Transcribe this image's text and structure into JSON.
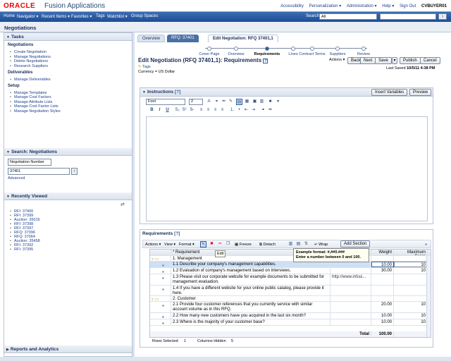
{
  "header": {
    "logo": "ORACLE",
    "app_name": "Fusion Applications",
    "links": [
      "Accessibility",
      "Personalization ▾",
      "Administration ▾",
      "Help ▾",
      "Sign Out",
      "CVBUYER01"
    ]
  },
  "nav": {
    "items": [
      "Home",
      "Navigator ▾",
      "Recent Items ▾",
      "Favorites ▾",
      "Tags",
      "Watchlist ▾",
      "Group Spaces"
    ],
    "search_label": "Search",
    "search_scope": "All"
  },
  "page_title": "Negotiations",
  "tasks": {
    "title": "Tasks",
    "groups": [
      {
        "label": "Negotiations",
        "links": [
          "Create Negotiation",
          "Manage Negotiations",
          "Delete Negotiations",
          "Research Suppliers"
        ]
      },
      {
        "label": "Deliverables",
        "links": [
          "Manage Deliverables"
        ]
      },
      {
        "label": "Setup",
        "links": [
          "Manage Templates",
          "Manage Cost Factors",
          "Manage Attribute Lists",
          "Manage Cost Factor Lists",
          "Manage Negotiation Styles"
        ]
      }
    ]
  },
  "search_panel": {
    "title": "Search: Negotiations",
    "field": "Negotiation Number",
    "value": "37401",
    "advanced": "Advanced"
  },
  "recent": {
    "title": "Recently Viewed",
    "items": [
      "RFI: 37400",
      "RFI: 37399",
      "Auction: 35016",
      "RFI: 37398",
      "RFI: 37397",
      "RFQ: 37396",
      "RFQ: 37064",
      "Auction: 35458",
      "RFI: 37392",
      "RFI: 37395"
    ]
  },
  "reports": {
    "title": "Reports and Analytics"
  },
  "tabs": [
    "Overview",
    "RFQ: 37401",
    "Edit Negotiation: RFQ 37401,1"
  ],
  "train": [
    "Cover Page",
    "Overview",
    "Requirements",
    "Lines",
    "Contract Terms",
    "Suppliers",
    "Review"
  ],
  "form": {
    "title": "Edit Negotiation (RFQ 37401,1): Requirements",
    "tags": "Tags",
    "currency": "Currency = US Dollar",
    "actions": "Actions ▾",
    "back": "Back",
    "next": "Next",
    "save": "Save",
    "publish": "Publish",
    "cancel": "Cancel",
    "last_saved_label": "Last Saved",
    "last_saved": "10/5/11 4:38 PM"
  },
  "instructions": {
    "title": "Instructions",
    "insert_vars": "Insert Variables",
    "preview": "Preview",
    "font": "Font",
    "size": "2"
  },
  "requirements": {
    "title": "Requirements",
    "actions": "Actions ▾",
    "view": "View ▾",
    "format": "Format ▾",
    "freeze": "Freeze",
    "detach": "Detach",
    "wrap": "Wrap",
    "add_section": "Add Section",
    "edit_tip": "Edit",
    "tip_line1": "Example format: #,##0.###",
    "tip_line2": "Enter a number between 0 and 100.",
    "columns": [
      "* Requirement",
      "",
      "Weight",
      "Maximum Score"
    ],
    "rows": [
      {
        "text": "1. Management",
        "section": true,
        "value": "",
        "weight": "",
        "max": ""
      },
      {
        "text": "1.1 Describe your company's management capabilities.",
        "section": false,
        "value": "",
        "weight": "10.00",
        "max": "10",
        "selected": true
      },
      {
        "text": "1.2 Evaluation of company's management based on interviews.",
        "section": false,
        "value": "",
        "weight": "30.00",
        "max": "10"
      },
      {
        "text": "1.3 Please visit our corporate website for example documents to be submitted for management evaluation.",
        "section": false,
        "value": "http://www.infusi...",
        "weight": "",
        "max": ""
      },
      {
        "text": "1.4 If you have a different website for your online public catalog, please provide it here.",
        "section": false,
        "value": "",
        "weight": "",
        "max": ""
      },
      {
        "text": "2. Customer",
        "section": true,
        "value": "",
        "weight": "",
        "max": ""
      },
      {
        "text": "2.1 Provide four customer references that you currently service with similar account volume as in this RFQ.",
        "section": false,
        "value": "",
        "weight": "20.00",
        "max": "10"
      },
      {
        "text": "2.2 How many new customers have you acquired in the last six month?",
        "section": false,
        "value": "",
        "weight": "10.00",
        "max": "10"
      },
      {
        "text": "2.3 Where is the majority of your customer base?",
        "section": false,
        "value": "",
        "weight": "10.00",
        "max": "10"
      }
    ],
    "total_label": "Total",
    "total_value": "100.00",
    "rows_selected_label": "Rows Selected",
    "rows_selected": "1",
    "columns_hidden_label": "Columns Hidden",
    "columns_hidden": "5"
  }
}
